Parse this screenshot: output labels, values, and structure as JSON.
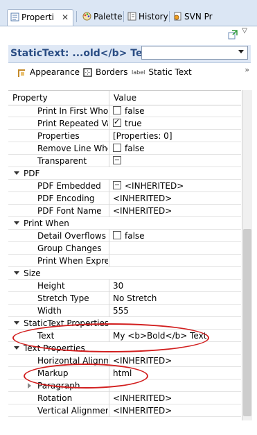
{
  "tabs": [
    {
      "label": "Properti",
      "icon": "properties-icon",
      "active": true
    },
    {
      "label": "Palette",
      "icon": "palette-icon"
    },
    {
      "label": "History",
      "icon": "history-icon"
    },
    {
      "label": "SVN Pr",
      "icon": "svn-icon"
    }
  ],
  "title": "StaticText: ...old</b> Text",
  "combo": {
    "value": ""
  },
  "section_tabs": [
    {
      "label": "Appearance",
      "icon": "appearance-icon"
    },
    {
      "label": "Borders",
      "icon": "borders-icon"
    },
    {
      "label": "Static Text",
      "icon": "label-icon",
      "icon_text": "label"
    }
  ],
  "more_glyph": "»",
  "header": {
    "property": "Property",
    "value": "Value"
  },
  "rows": [
    {
      "type": "prop",
      "name": "Print In First Whole",
      "checkbox": "unchecked",
      "value": "false"
    },
    {
      "type": "prop",
      "name": "Print Repeated Valu",
      "checkbox": "checked",
      "value": "true"
    },
    {
      "type": "prop",
      "name": "Properties",
      "value": "[Properties: 0]"
    },
    {
      "type": "prop",
      "name": "Remove Line When",
      "checkbox": "unchecked",
      "value": "false"
    },
    {
      "type": "prop",
      "name": "Transparent",
      "checkbox": "tri",
      "value": ""
    },
    {
      "type": "cat",
      "name": "PDF"
    },
    {
      "type": "prop",
      "name": "PDF Embedded",
      "checkbox": "tri",
      "value": "<INHERITED>"
    },
    {
      "type": "prop",
      "name": "PDF Encoding",
      "value": "<INHERITED>"
    },
    {
      "type": "prop",
      "name": "PDF Font Name",
      "value": "<INHERITED>"
    },
    {
      "type": "cat",
      "name": "Print When"
    },
    {
      "type": "prop",
      "name": "Detail Overflows",
      "checkbox": "unchecked",
      "value": "false"
    },
    {
      "type": "prop",
      "name": "Group Changes",
      "value": ""
    },
    {
      "type": "prop",
      "name": "Print When Expressi",
      "value": ""
    },
    {
      "type": "cat",
      "name": "Size"
    },
    {
      "type": "prop",
      "name": "Height",
      "value": "30"
    },
    {
      "type": "prop",
      "name": "Stretch Type",
      "value": "No Stretch"
    },
    {
      "type": "prop",
      "name": "Width",
      "value": "555"
    },
    {
      "type": "cat",
      "name": "StaticText Properties"
    },
    {
      "type": "prop",
      "name": "Text",
      "value": "My <b>Bold</b> Text"
    },
    {
      "type": "cat",
      "name": "Text Properties"
    },
    {
      "type": "prop",
      "name": "Horizontal Alignme",
      "value": "<INHERITED>"
    },
    {
      "type": "prop",
      "name": "Markup",
      "value": "html"
    },
    {
      "type": "sub",
      "name": "Paragraph",
      "value": ""
    },
    {
      "type": "prop",
      "name": "Rotation",
      "value": "<INHERITED>"
    },
    {
      "type": "prop",
      "name": "Vertical Alignment",
      "value": "<INHERITED>"
    }
  ]
}
